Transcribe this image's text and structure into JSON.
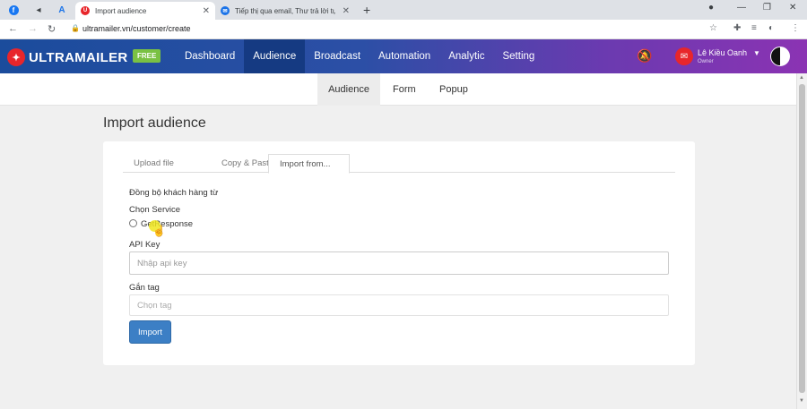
{
  "browser": {
    "tabs": [
      {
        "title": "Import audience",
        "active": true
      },
      {
        "title": "Tiếp thị qua email, Thư trả lời tự",
        "active": false
      }
    ],
    "url": "ultramailer.vn/customer/create"
  },
  "header": {
    "logo_text": "ULTRAMAILER",
    "badge": "FREE",
    "nav": [
      {
        "label": "Dashboard",
        "active": false
      },
      {
        "label": "Audience",
        "active": true
      },
      {
        "label": "Broadcast",
        "active": false
      },
      {
        "label": "Automation",
        "active": false
      },
      {
        "label": "Analytic",
        "active": false
      },
      {
        "label": "Setting",
        "active": false
      }
    ],
    "user": {
      "name": "Lê Kiều Oanh",
      "role": "Owner"
    }
  },
  "subnav": [
    {
      "label": "Audience",
      "active": true
    },
    {
      "label": "Form",
      "active": false
    },
    {
      "label": "Popup",
      "active": false
    }
  ],
  "main": {
    "title": "Import audience",
    "tabs": [
      {
        "label": "Upload file",
        "active": false
      },
      {
        "label": "Copy & Paste",
        "active": false
      },
      {
        "label": "Import from...",
        "active": true
      }
    ],
    "section_label": "Đồng bộ khách hàng từ",
    "service_label": "Chọn Service",
    "service_option": "GetResponse",
    "api_key_label": "API Key",
    "api_key_placeholder": "Nhập api key",
    "tag_label": "Gắn tag",
    "tag_placeholder": "Chọn tag",
    "import_button": "Import"
  },
  "colors": {
    "header_start": "#1b4c9c",
    "header_end": "#8b33b3",
    "primary_button": "#3c7fc5",
    "free_badge": "#7ac143",
    "logo_red": "#e8262b"
  }
}
